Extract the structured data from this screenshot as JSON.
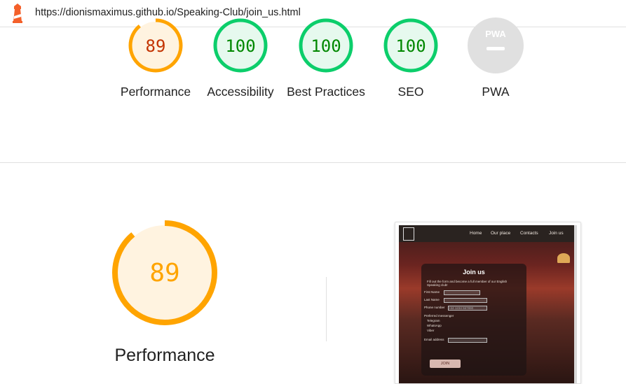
{
  "url": "https://dionismaximus.github.io/Speaking-Club/join_us.html",
  "colors": {
    "average": "#ffa400",
    "pass": "#0cce6b",
    "na": "#e0e0e0",
    "average_text": "#c33300",
    "pass_text": "#008800"
  },
  "gauges": [
    {
      "score": "89",
      "value": 89,
      "label": "Performance",
      "status": "average"
    },
    {
      "score": "100",
      "value": 100,
      "label": "Accessibility",
      "status": "pass"
    },
    {
      "score": "100",
      "value": 100,
      "label": "Best Practices",
      "status": "pass"
    },
    {
      "score": "100",
      "value": 100,
      "label": "SEO",
      "status": "pass"
    },
    {
      "score": "PWA",
      "value": null,
      "label": "PWA",
      "status": "na"
    }
  ],
  "main": {
    "score": "89",
    "value": 89,
    "label": "Performance"
  },
  "screenshot": {
    "nav": [
      "Home",
      "Our place",
      "Contacts",
      "Join us"
    ],
    "title": "Join us",
    "intro": "Fill out the form and become a full member of our English Speaking club!",
    "first_name": "First Name",
    "last_name": "Last Name",
    "phone": "Phone number",
    "phone_placeholder": "+44 1234 567890",
    "messenger_label": "Preferred messenger",
    "messengers": [
      "Telegram",
      "WhatsApp",
      "Viber"
    ],
    "email": "Email address",
    "button": "JOIN"
  }
}
